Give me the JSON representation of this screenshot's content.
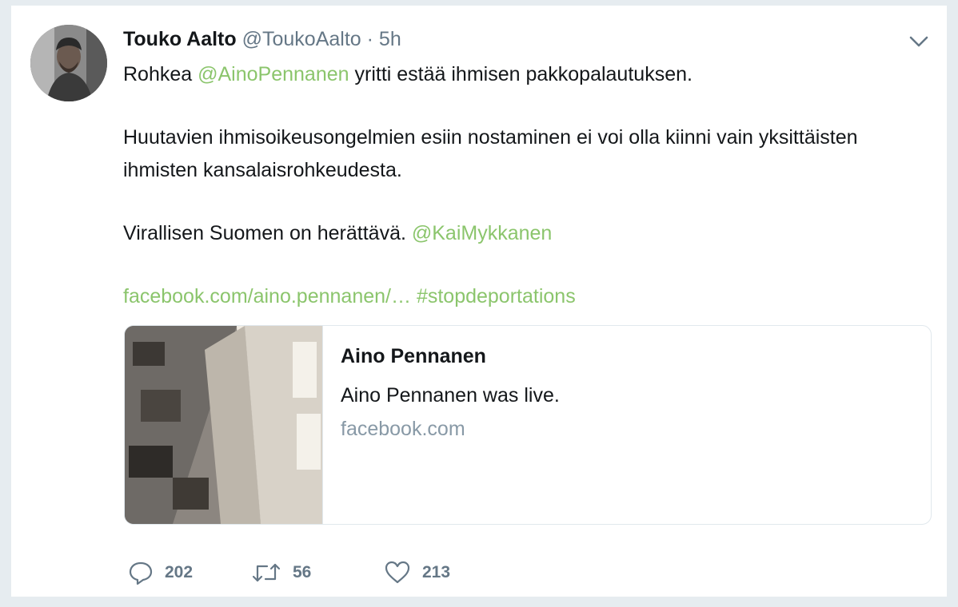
{
  "tweet": {
    "fullname": "Touko Aalto",
    "username": "@ToukoAalto",
    "separator": "·",
    "time": "5h",
    "line1_pre": "Rohkea ",
    "line1_mention": "@AinoPennanen",
    "line1_post": " yritti estää ihmisen pakkopalautuksen.",
    "paragraph2": "Huutavien ihmisoikeusongelmien esiin nostaminen ei voi olla kiinni vain yksittäisten ihmisten kansalaisrohkeudesta.",
    "line3_pre": "Virallisen Suomen on herättävä. ",
    "line3_mention": "@KaiMykkanen",
    "link_url": "facebook.com/aino.pennanen/…",
    "hashtag": "#stopdeportations"
  },
  "card": {
    "title": "Aino Pennanen",
    "description": "Aino Pennanen was live.",
    "domain": "facebook.com"
  },
  "actions": {
    "replies": "202",
    "retweets": "56",
    "likes": "213"
  },
  "colors": {
    "link": "#8bc56c",
    "text": "#14171a",
    "muted": "#657786"
  },
  "icons": [
    "chevron-down-icon",
    "reply-icon",
    "retweet-icon",
    "heart-icon"
  ]
}
